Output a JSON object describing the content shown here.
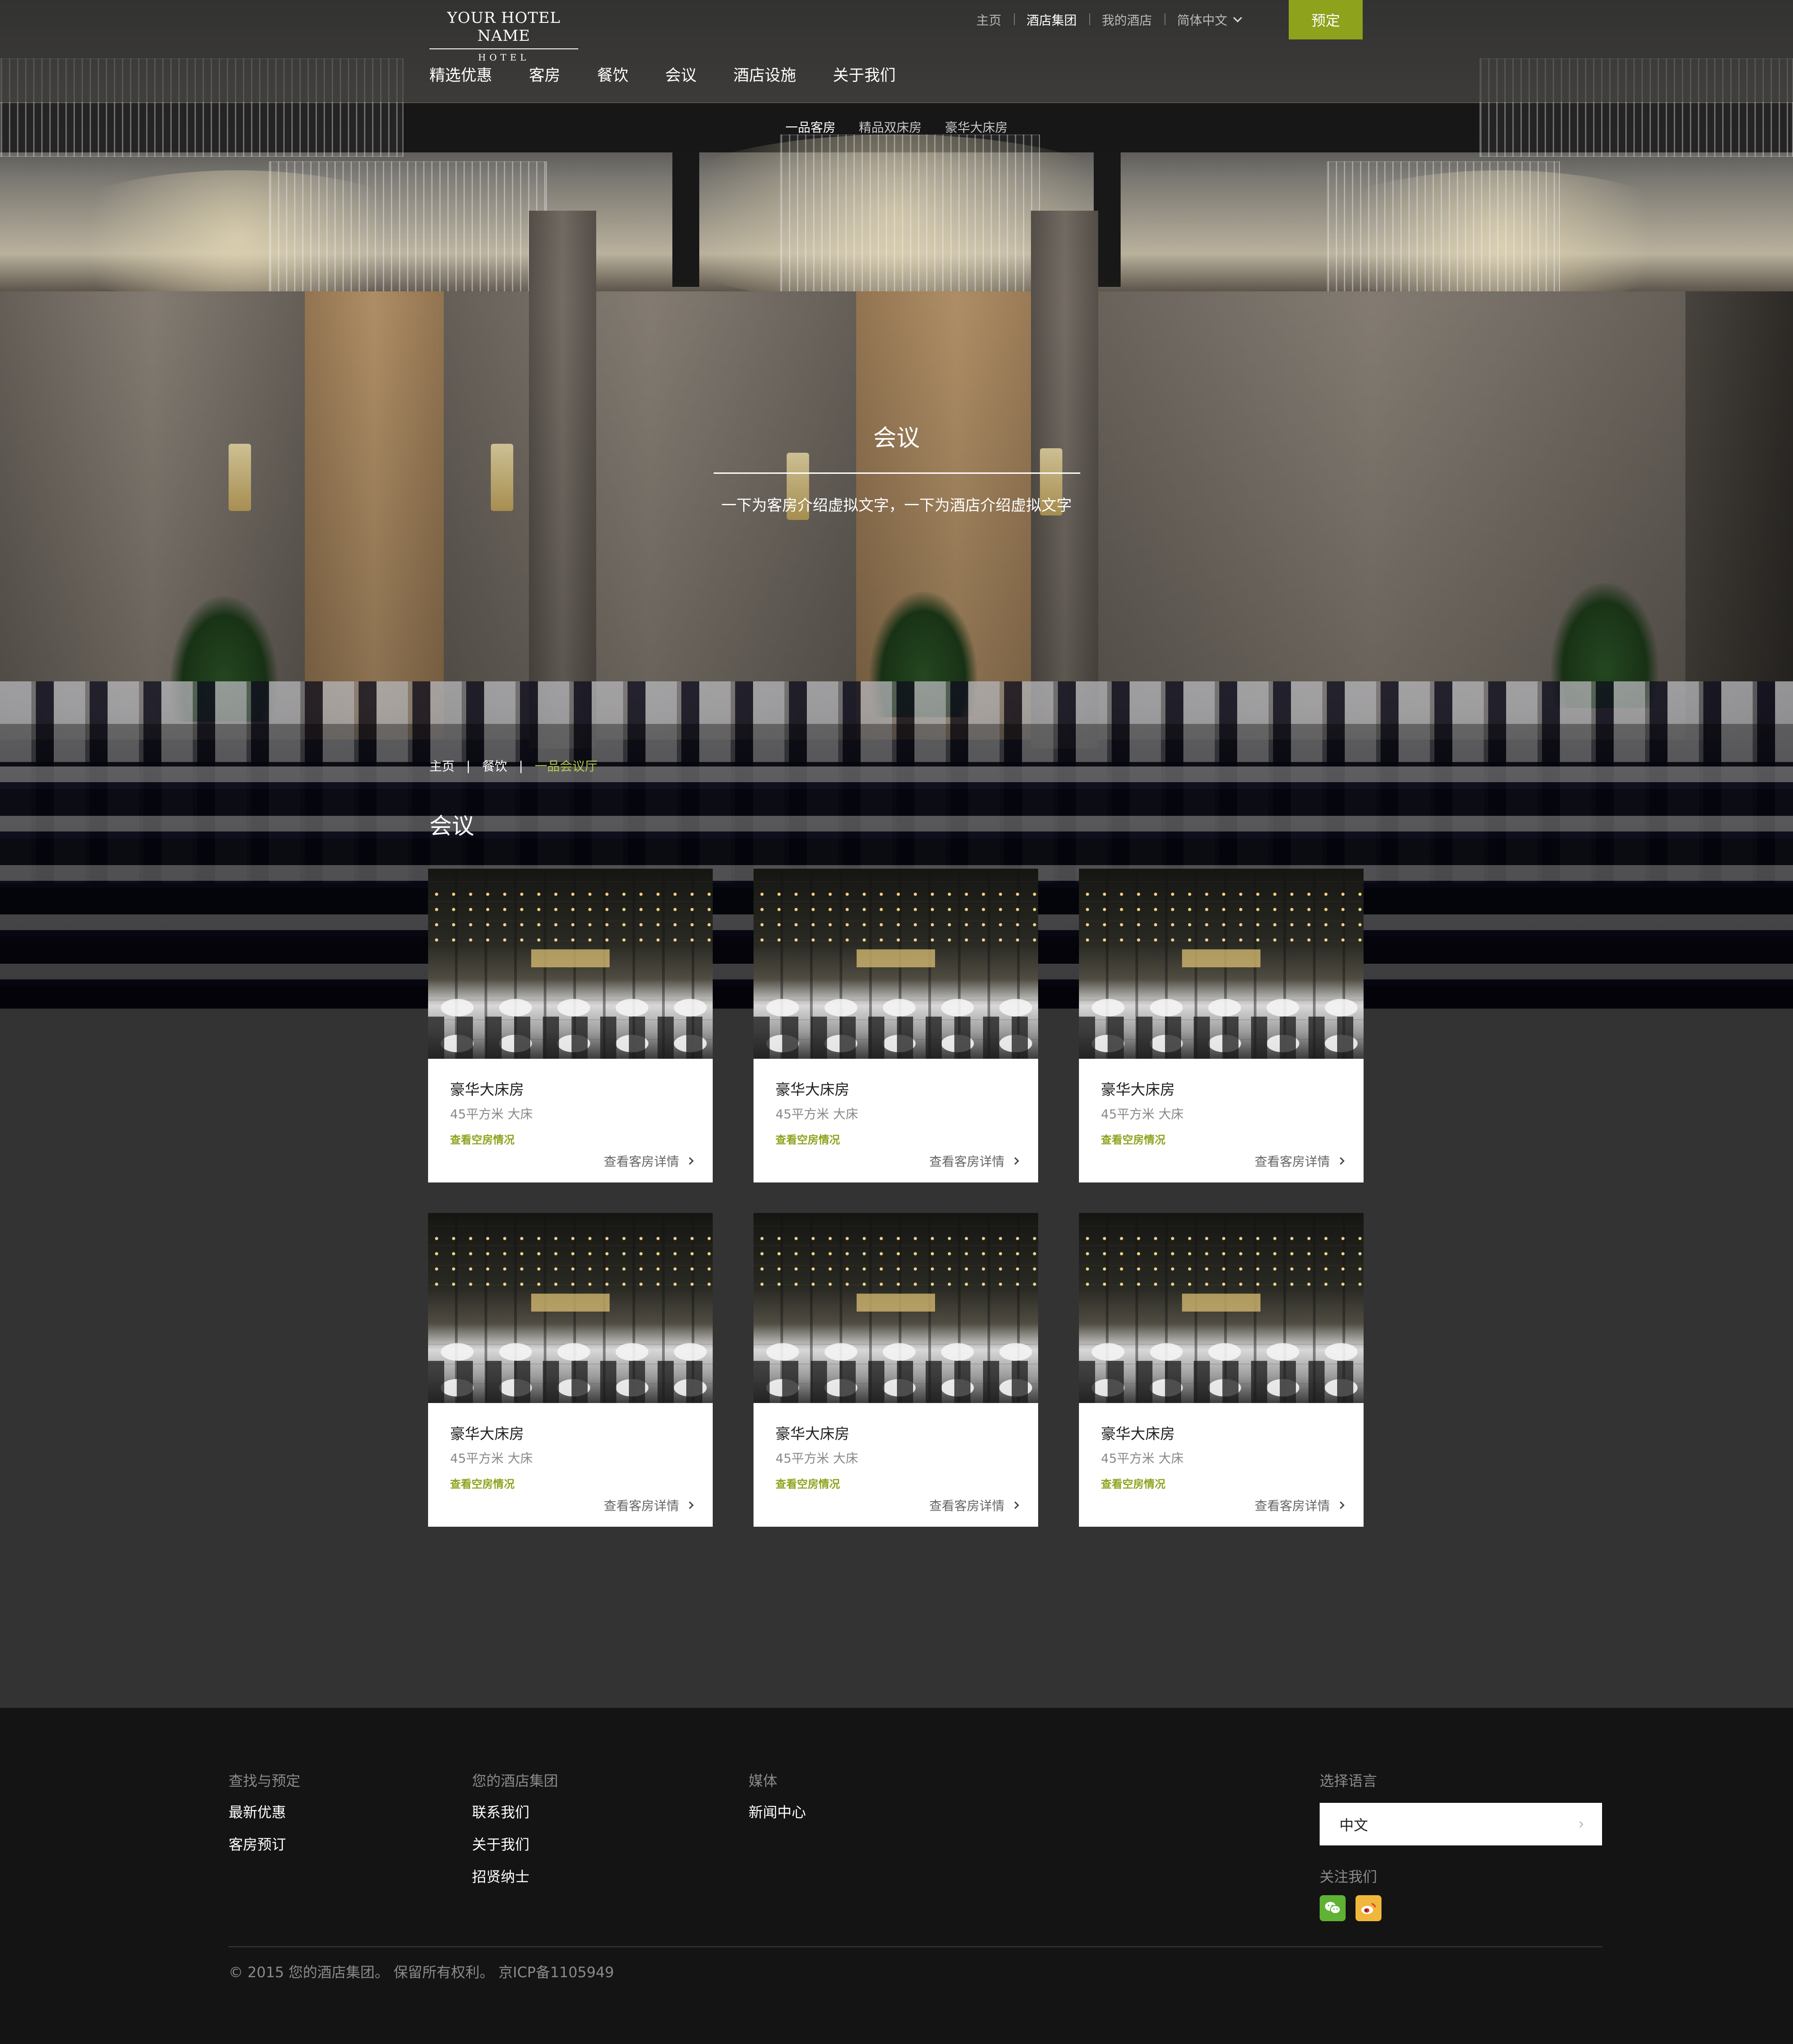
{
  "colors": {
    "accent": "#8ea21c",
    "breadcrumb_current": "#b6c84a",
    "content_bg": "#333333",
    "footer_bg": "#141414"
  },
  "header": {
    "logo": {
      "name": "YOUR HOTEL NAME",
      "sub": "HOTEL"
    },
    "top_links": [
      "主页",
      "酒店集团",
      "我的酒店"
    ],
    "active_top_link": "酒店集团",
    "language": "简体中文",
    "book_label": "预定",
    "nav": [
      "精选优惠",
      "客房",
      "餐饮",
      "会议",
      "酒店设施",
      "关于我们"
    ],
    "subnav": [
      "一品客房",
      "精品双床房",
      "豪华大床房"
    ]
  },
  "hero": {
    "title": "会议",
    "description": "一下为客房介绍虚拟文字，一下为酒店介绍虚拟文字"
  },
  "breadcrumb": [
    "主页",
    "餐饮",
    "一品会议厅"
  ],
  "section_title": "会议",
  "rooms": [
    {
      "name": "豪华大床房",
      "info": "45平方米   大床",
      "availability": "查看空房情况",
      "details": "查看客房详情"
    },
    {
      "name": "豪华大床房",
      "info": "45平方米   大床",
      "availability": "查看空房情况",
      "details": "查看客房详情"
    },
    {
      "name": "豪华大床房",
      "info": "45平方米   大床",
      "availability": "查看空房情况",
      "details": "查看客房详情"
    },
    {
      "name": "豪华大床房",
      "info": "45平方米   大床",
      "availability": "查看空房情况",
      "details": "查看客房详情"
    },
    {
      "name": "豪华大床房",
      "info": "45平方米   大床",
      "availability": "查看空房情况",
      "details": "查看客房详情"
    },
    {
      "name": "豪华大床房",
      "info": "45平方米   大床",
      "availability": "查看空房情况",
      "details": "查看客房详情"
    }
  ],
  "footer": {
    "col1": {
      "heading": "查找与预定",
      "links": [
        "最新优惠",
        "客房预订"
      ]
    },
    "col2": {
      "heading": "您的酒店集团",
      "links": [
        "联系我们",
        "关于我们",
        "招贤纳士"
      ]
    },
    "col3": {
      "heading": "媒体",
      "links": [
        "新闻中心"
      ]
    },
    "language": {
      "heading": "选择语言",
      "value": "中文"
    },
    "follow": {
      "heading": "关注我们",
      "icons": [
        "wechat-icon",
        "weibo-icon"
      ]
    },
    "copyright": "© 2015 您的酒店集团。 保留所有权利。 京ICP备1105949"
  }
}
